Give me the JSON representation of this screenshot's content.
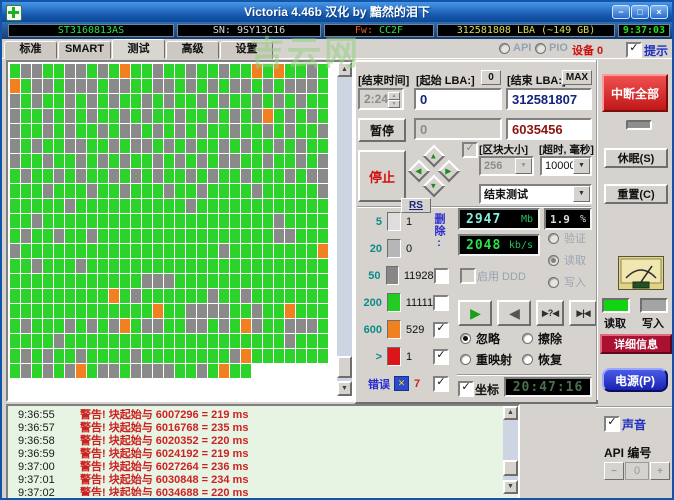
{
  "window": {
    "title": "Victoria 4.46b 汉化 by 黯然的泪下",
    "watermark": "吉云网",
    "minimize": "−",
    "maximize": "□",
    "close": "×"
  },
  "infobar": {
    "model": "ST3160813AS",
    "sn": "SN: 9SY13C16",
    "fw_label": "Fw:",
    "fw_value": "CC2F",
    "lba": "312581808 LBA (~149 GB)",
    "clock": "9:37:03"
  },
  "tabbar": {
    "tabs": [
      "标准",
      "SMART",
      "测试",
      "高级",
      "设置"
    ],
    "active": "测试",
    "api": "API",
    "pio": "PIO",
    "device": "设备 0",
    "hint": "提示"
  },
  "controls": {
    "end_time_label": "[结束时间]",
    "end_time_value": "2:24",
    "start_lba_label": "[起始 LBA:]",
    "zero_button": "0",
    "start_lba_value": "0",
    "end_lba_label": "[结束 LBA:]",
    "max_button": "MAX",
    "end_lba_value": "312581807",
    "position_value": "0",
    "current_block_value": "6035456",
    "pause_button": "暂停",
    "stop_button": "停止",
    "block_size_label": "[区块大小]",
    "block_size_value": "256",
    "timeout_label": "[超时, 毫秒]",
    "timeout_value": "10000",
    "after_test_value": "结束测试",
    "rs_button": "RS",
    "category_column_label": "删除:"
  },
  "legend": {
    "rows": [
      {
        "scale": "5",
        "count": "1",
        "color": "#dedede",
        "checked": null,
        "count_color": "#101010"
      },
      {
        "scale": "20",
        "count": "0",
        "color": "#b6b6b6",
        "checked": null,
        "count_color": "#101010"
      },
      {
        "scale": "50",
        "count": "11928",
        "color": "#878787",
        "checked": false,
        "count_color": "#101010"
      },
      {
        "scale": "200",
        "count": "11111",
        "color": "#22cc22",
        "checked": false,
        "count_color": "#101010"
      },
      {
        "scale": "600",
        "count": "529",
        "color": "#f08020",
        "checked": true,
        "count_color": "#101010"
      },
      {
        "scale": ">",
        "count": "1",
        "color": "#dd1418",
        "checked": true,
        "count_color": "#101010"
      },
      {
        "scale": "错误",
        "count": "7",
        "color": "error-icon",
        "checked": true,
        "count_color": "#cc2020"
      }
    ]
  },
  "status": {
    "mb_value": "2947",
    "mb_unit": "Mb",
    "pct_value": "1.9",
    "pct_unit": "%",
    "speed_value": "2048",
    "speed_unit": "kb/s",
    "ddd_label": "启用 DDD",
    "mode_radios": [
      {
        "label": "验证",
        "selected": false
      },
      {
        "label": "读取",
        "selected": true
      },
      {
        "label": "写入",
        "selected": false
      }
    ],
    "action_radios": [
      {
        "label": "忽略",
        "selected": true
      },
      {
        "label": "擦除",
        "selected": false
      },
      {
        "label": "重映射",
        "selected": false
      },
      {
        "label": "恢复",
        "selected": false
      }
    ],
    "coord_label": "坐标",
    "time_lcd": "20:47:16"
  },
  "transport": [
    {
      "name": "play",
      "glyph": "▶",
      "color": "#18a018",
      "size": "14px"
    },
    {
      "name": "step-back",
      "glyph": "◀",
      "color": "#545454",
      "size": "14px"
    },
    {
      "name": "seek-question",
      "glyph": "▶?◀",
      "color": "#303030",
      "size": "9px"
    },
    {
      "name": "seek-edge",
      "glyph": "▶|◀",
      "color": "#303030",
      "size": "9px"
    }
  ],
  "right": {
    "abort_button": "中断全部",
    "sleep_button": "休眠(S)",
    "reset_button": "重置(C)",
    "read_label": "读取",
    "write_label": "写入",
    "details_button": "详细信息",
    "power_button": "电源(P)",
    "sound_label": "声音",
    "api_label": "API 编号",
    "api_value": "0",
    "minus": "−",
    "plus": "+"
  },
  "log": {
    "entries": [
      {
        "time": "9:36:55",
        "msg": "警告! 块起始与 6007296 = 219 ms"
      },
      {
        "time": "9:36:57",
        "msg": "警告! 块起始与 6016768 = 235 ms"
      },
      {
        "time": "9:36:58",
        "msg": "警告! 块起始与 6020352 = 220 ms"
      },
      {
        "time": "9:36:59",
        "msg": "警告! 块起始与 6024192 = 219 ms"
      },
      {
        "time": "9:37:00",
        "msg": "警告! 块起始与 6027264 = 236 ms"
      },
      {
        "time": "9:37:01",
        "msg": "警告! 块起始与 6030848 = 234 ms"
      },
      {
        "time": "9:37:02",
        "msg": "警告! 块起始与 6034688 = 220 ms"
      }
    ]
  },
  "grid": {
    "cols": 29,
    "cell_colors": {
      "g": "#2bd32b",
      "d": "#8a8a8a",
      "o": "#f08020"
    },
    "rows": [
      "gddggddgdgoggdggdggdggogoggdg",
      "ogddgdddgddggddgdgdgddgdgdddg",
      "dgdggdgdgdggdgdggdgdggdgdgdgg",
      "dggdgdgdggdgdggdggdgdgdogdgdg",
      "dggdgdggdgddgdgdgdggdggdgdggd",
      "dgdggddggdgddgdgdggdgdggdgdgg",
      "dggdggdgdgdggdgdgdgddggdggdgd",
      "gdggdgdggdgdgdggdgdggdgggdgdd",
      "gggdgggdggdgggdggdggggdgggggd",
      "gggggdggggggggggdgggggggggggg",
      "ggdgggggggggggggggggggggdgggg",
      "gdggdggdggggggggggggggggddggg",
      "dggggggggggggggggggdggggggggo",
      "ggdgggdgggggggggggggggggggggg",
      "ggggggggggggdddgggggggggggggg",
      "gggggggggogdggggggdggdggggggg",
      "gggggggggggggoggddddggdggoggg",
      "gdgggdgdgdogddggddgdgodggdddg",
      "ggggdggggggggggggggggggggdggg",
      "gdgdggdggggdggggggggdoggggggg",
      "gdgdgdogddgddddggdgogg"
    ]
  },
  "icons": {
    "check": "✓",
    "scroll_up": "▲",
    "scroll_down": "▼",
    "dropdown": "▼",
    "spinner_up": "▲",
    "spinner_down": "▼",
    "dpad_up": "▲",
    "dpad_down": "▼",
    "dpad_left": "◀",
    "dpad_right": "▶",
    "error_x": "✕"
  }
}
